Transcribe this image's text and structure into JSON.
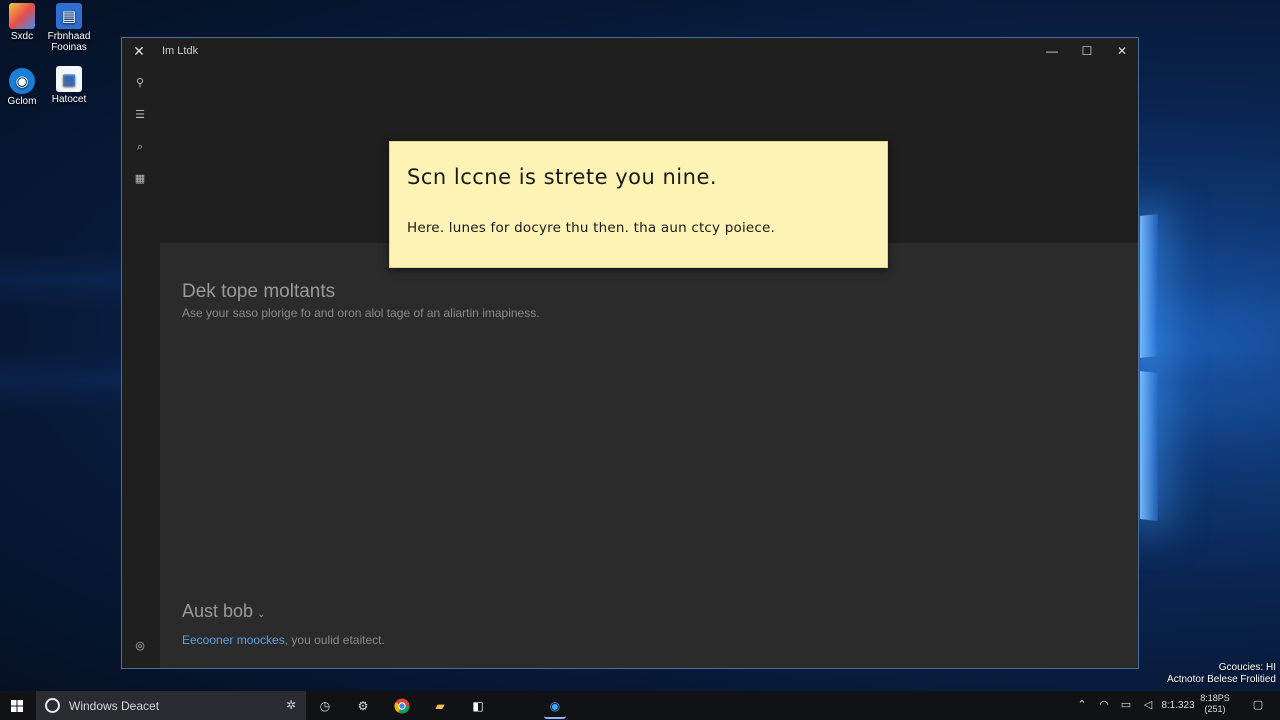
{
  "desktop": {
    "icons": [
      {
        "label": "Sxdc",
        "icon": "color-app-icon"
      },
      {
        "label": "Frbnhaad Fooinas",
        "icon": "blue-document-icon"
      },
      {
        "label": "Gclom",
        "icon": "edge-browser-icon"
      },
      {
        "label": "Hatocet",
        "icon": "document-icon"
      }
    ],
    "notification": {
      "line1": "Gcoucies: HI",
      "line2": "Actnotor Belese Frolitied"
    }
  },
  "window": {
    "title": "Im Ltdk",
    "controls": {
      "minimize": "—",
      "maximize": "☐",
      "close": "✕"
    },
    "rail_icons": [
      "pin-icon",
      "list-icon",
      "search-icon",
      "calendar-icon",
      "settings-icon"
    ]
  },
  "main": {
    "heading": "Dek tope moltants",
    "subtext": "Ase your saso plorige fo and oron alol tage of an aliartin imapiness.",
    "section2_title": "Aust bob",
    "section2_caret": "⌄",
    "link_text": "Eecooner moockes",
    "link_suffix": ", you oulid etaitect."
  },
  "note": {
    "title": "Scn lccne is strete you nine.",
    "body": "Here. lunes for docyre thu then. tha aun ctcy poiece."
  },
  "taskbar": {
    "search_text": "Windows Deacet",
    "apps": [
      "clock-app-icon",
      "steam-icon",
      "chrome-icon",
      "file-explorer-icon",
      "store-icon",
      "edge-icon"
    ],
    "clock_line1": "8:18PS",
    "clock_line2": "(251)",
    "tray_time": "8:1.323"
  },
  "colors": {
    "accent": "#5aa3e8",
    "note_bg": "#fcf3b5",
    "window_bg": "#1f1f1f",
    "content_bg": "#2b2b2b"
  }
}
